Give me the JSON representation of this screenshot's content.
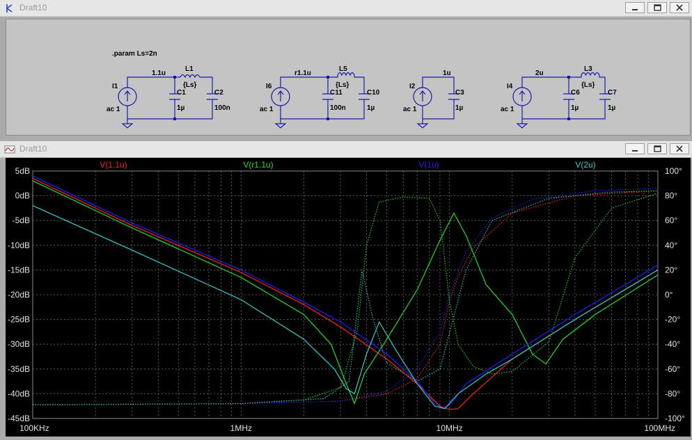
{
  "schematic_window": {
    "title": "Draft10"
  },
  "plot_window": {
    "title": "Draft10"
  },
  "schematic": {
    "directive": ".param Ls=2n",
    "circuits": [
      {
        "source": "I1",
        "source_value": "ac 1",
        "net": "1.1u",
        "caps": [
          {
            "name": "C1",
            "value": "1µ"
          },
          {
            "name": "C2",
            "value": "100n"
          }
        ],
        "inductor": {
          "name": "L1",
          "value": "{Ls}"
        }
      },
      {
        "source": "I6",
        "source_value": "ac 1",
        "net": "r1.1u",
        "caps": [
          {
            "name": "C11",
            "value": "100n"
          },
          {
            "name": "C10",
            "value": "1µ"
          }
        ],
        "inductor": {
          "name": "L5",
          "value": "{Ls}"
        }
      },
      {
        "source": "I2",
        "source_value": "ac 1",
        "net": "1u",
        "caps": [
          {
            "name": "C3",
            "value": "1µ"
          }
        ]
      },
      {
        "source": "I4",
        "source_value": "ac 1",
        "net": "2u",
        "caps": [
          {
            "name": "C6",
            "value": "1µ"
          },
          {
            "name": "C7",
            "value": "1µ"
          }
        ],
        "inductor": {
          "name": "L3",
          "value": "{Ls}"
        }
      }
    ]
  },
  "chart_data": {
    "type": "line",
    "x_scale": "log",
    "xlim": [
      100000,
      100000000
    ],
    "ylim_left": [
      -45,
      5
    ],
    "ylim_right": [
      -100,
      100
    ],
    "x_ticks": [
      {
        "v": 100000,
        "label": "100KHz"
      },
      {
        "v": 1000000,
        "label": "1MHz"
      },
      {
        "v": 10000000,
        "label": "10MHz"
      },
      {
        "v": 100000000,
        "label": "100MHz"
      }
    ],
    "y_ticks_left": [
      {
        "v": 5,
        "label": "5dB"
      },
      {
        "v": 0,
        "label": "0dB"
      },
      {
        "v": -5,
        "label": "-5dB"
      },
      {
        "v": -10,
        "label": "-10dB"
      },
      {
        "v": -15,
        "label": "-15dB"
      },
      {
        "v": -20,
        "label": "-20dB"
      },
      {
        "v": -25,
        "label": "-25dB"
      },
      {
        "v": -30,
        "label": "-30dB"
      },
      {
        "v": -35,
        "label": "-35dB"
      },
      {
        "v": -40,
        "label": "-40dB"
      },
      {
        "v": -45,
        "label": "-45dB"
      }
    ],
    "y_ticks_right": [
      {
        "v": 100,
        "label": "100°"
      },
      {
        "v": 80,
        "label": "80°"
      },
      {
        "v": 60,
        "label": "60°"
      },
      {
        "v": 40,
        "label": "40°"
      },
      {
        "v": 20,
        "label": "20°"
      },
      {
        "v": 0,
        "label": "0°"
      },
      {
        "v": -20,
        "label": "-20°"
      },
      {
        "v": -40,
        "label": "-40°"
      },
      {
        "v": -60,
        "label": "-60°"
      },
      {
        "v": -80,
        "label": "-80°"
      },
      {
        "v": -100,
        "label": "-100°"
      }
    ],
    "grid": true,
    "background": "#000000",
    "series": [
      {
        "name": "V(1.1u)",
        "color": "#ff2020",
        "mag": [
          [
            100000,
            3.5
          ],
          [
            300000,
            -6
          ],
          [
            1000000,
            -15.5
          ],
          [
            2000000,
            -22
          ],
          [
            3000000,
            -26.5
          ],
          [
            5000000,
            -33
          ],
          [
            7000000,
            -38
          ],
          [
            9000000,
            -42.5
          ],
          [
            10000000,
            -43.2
          ],
          [
            11000000,
            -43
          ],
          [
            13000000,
            -40
          ],
          [
            20000000,
            -33
          ],
          [
            40000000,
            -25
          ],
          [
            100000000,
            -15
          ]
        ],
        "phase": [
          [
            100000,
            -89
          ],
          [
            1000000,
            -88
          ],
          [
            3000000,
            -86
          ],
          [
            5000000,
            -80
          ],
          [
            7000000,
            -68
          ],
          [
            9000000,
            -40
          ],
          [
            10000000,
            -5
          ],
          [
            11000000,
            15
          ],
          [
            13000000,
            38
          ],
          [
            20000000,
            66
          ],
          [
            40000000,
            80
          ],
          [
            100000000,
            84
          ]
        ]
      },
      {
        "name": "V(r1.1u)",
        "color": "#20e020",
        "mag": [
          [
            100000,
            3
          ],
          [
            300000,
            -6.5
          ],
          [
            1000000,
            -16.5
          ],
          [
            2000000,
            -24
          ],
          [
            2700000,
            -30
          ],
          [
            3200000,
            -38
          ],
          [
            3500000,
            -42
          ],
          [
            3900000,
            -36
          ],
          [
            5000000,
            -29
          ],
          [
            7000000,
            -19
          ],
          [
            9000000,
            -9
          ],
          [
            10500000,
            -3.5
          ],
          [
            12000000,
            -8
          ],
          [
            15000000,
            -18
          ],
          [
            20000000,
            -24
          ],
          [
            25000000,
            -32
          ],
          [
            29000000,
            -34
          ],
          [
            35000000,
            -29
          ],
          [
            50000000,
            -24
          ],
          [
            100000000,
            -16
          ]
        ],
        "phase": [
          [
            100000,
            -89
          ],
          [
            1000000,
            -88
          ],
          [
            2000000,
            -85
          ],
          [
            3000000,
            -75
          ],
          [
            3600000,
            -30
          ],
          [
            4000000,
            40
          ],
          [
            4600000,
            75
          ],
          [
            6000000,
            79
          ],
          [
            8000000,
            78
          ],
          [
            9000000,
            60
          ],
          [
            10000000,
            -5
          ],
          [
            11000000,
            -40
          ],
          [
            13000000,
            -58
          ],
          [
            16000000,
            -64
          ],
          [
            20000000,
            -62
          ],
          [
            30000000,
            -38
          ],
          [
            40000000,
            30
          ],
          [
            60000000,
            70
          ],
          [
            100000000,
            82
          ]
        ]
      },
      {
        "name": "V(1u)",
        "color": "#2020ff",
        "mag": [
          [
            100000,
            4
          ],
          [
            300000,
            -5.5
          ],
          [
            1000000,
            -15
          ],
          [
            2000000,
            -21.5
          ],
          [
            3000000,
            -25.5
          ],
          [
            5000000,
            -32
          ],
          [
            7000000,
            -37.5
          ],
          [
            8500000,
            -42
          ],
          [
            9300000,
            -43
          ],
          [
            10200000,
            -42
          ],
          [
            12000000,
            -38
          ],
          [
            20000000,
            -32
          ],
          [
            40000000,
            -24
          ],
          [
            100000000,
            -14
          ]
        ],
        "phase": [
          [
            100000,
            -89
          ],
          [
            1000000,
            -88
          ],
          [
            3000000,
            -86
          ],
          [
            5000000,
            -78
          ],
          [
            7000000,
            -60
          ],
          [
            9000000,
            -30
          ],
          [
            10000000,
            0
          ],
          [
            12000000,
            35
          ],
          [
            16000000,
            62
          ],
          [
            25000000,
            77
          ],
          [
            50000000,
            84
          ],
          [
            100000000,
            86
          ]
        ]
      },
      {
        "name": "V(2u)",
        "color": "#30d0d0",
        "mag": [
          [
            100000,
            -2
          ],
          [
            300000,
            -11
          ],
          [
            1000000,
            -21
          ],
          [
            2000000,
            -29
          ],
          [
            2800000,
            -35
          ],
          [
            3200000,
            -39
          ],
          [
            3500000,
            -40
          ],
          [
            4000000,
            -32
          ],
          [
            4600000,
            -25.5
          ],
          [
            5500000,
            -31
          ],
          [
            7000000,
            -38
          ],
          [
            8500000,
            -42.5
          ],
          [
            9500000,
            -43
          ],
          [
            11000000,
            -40
          ],
          [
            15000000,
            -36
          ],
          [
            20000000,
            -33
          ],
          [
            40000000,
            -25
          ],
          [
            100000000,
            -15
          ]
        ],
        "phase": [
          [
            100000,
            -89
          ],
          [
            1000000,
            -88
          ],
          [
            2500000,
            -84
          ],
          [
            3300000,
            -70
          ],
          [
            3800000,
            20
          ],
          [
            4300000,
            -20
          ],
          [
            5000000,
            -55
          ],
          [
            7000000,
            -70
          ],
          [
            9000000,
            -60
          ],
          [
            12000000,
            20
          ],
          [
            16000000,
            60
          ],
          [
            30000000,
            78
          ],
          [
            60000000,
            83
          ],
          [
            100000000,
            84
          ]
        ]
      }
    ]
  }
}
